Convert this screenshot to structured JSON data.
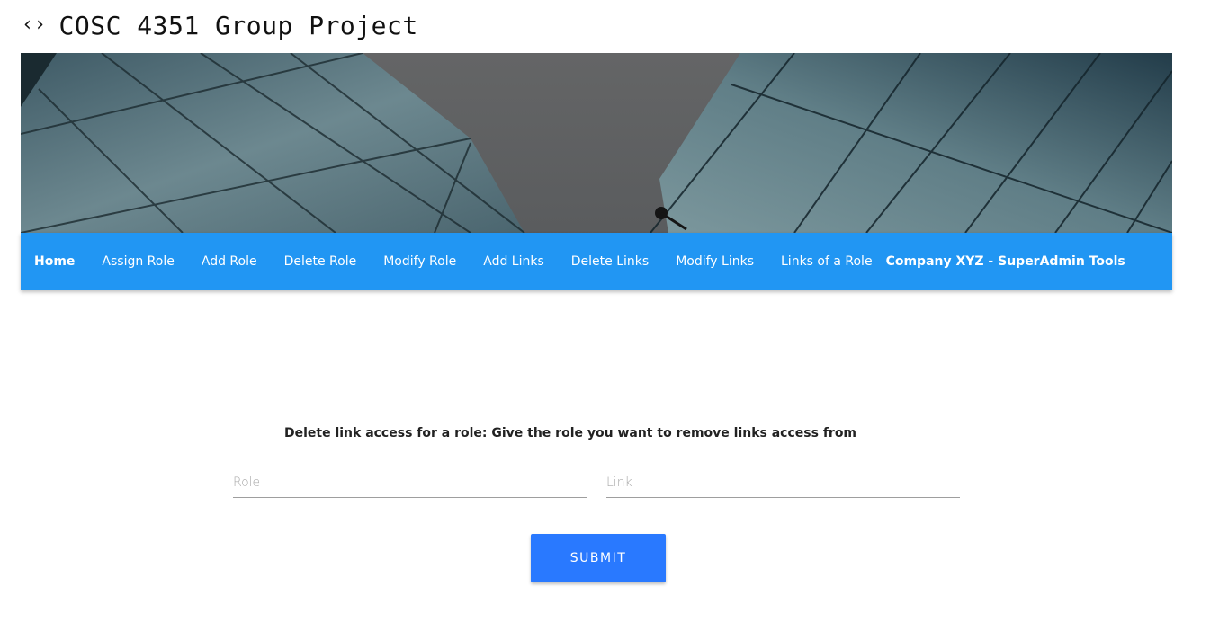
{
  "page": {
    "title": "COSC 4351 Group Project",
    "title_icon": "code-brackets-icon"
  },
  "banner": {
    "description_icon": "glass-building-banner"
  },
  "nav": {
    "items": [
      {
        "label": "Home"
      },
      {
        "label": "Assign Role"
      },
      {
        "label": "Add Role"
      },
      {
        "label": "Delete Role"
      },
      {
        "label": "Modify Role"
      },
      {
        "label": "Add Links"
      },
      {
        "label": "Delete Links"
      },
      {
        "label": "Modify Links"
      },
      {
        "label": "Links of a Role"
      }
    ],
    "brand": "Company XYZ - SuperAdmin Tools",
    "color": "#2196f3"
  },
  "form": {
    "heading": "Delete link access for a role: Give the role you want to remove links access from",
    "role_placeholder": "Role",
    "link_placeholder": "Link",
    "submit_label": "SUBMIT",
    "button_color": "#2979ff"
  }
}
